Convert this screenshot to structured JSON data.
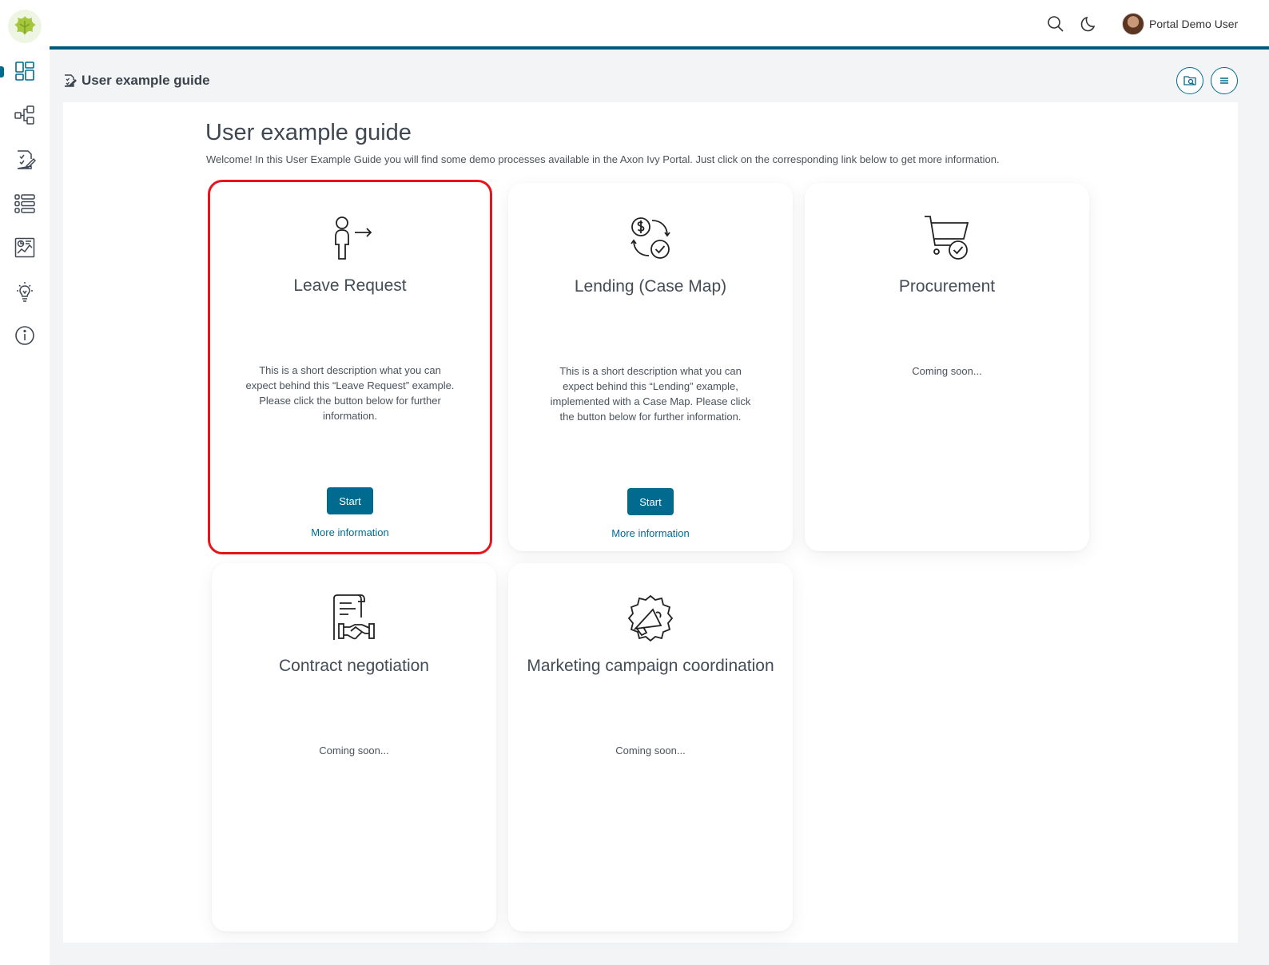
{
  "app": {
    "user_name": "Portal Demo User"
  },
  "sidebar": {
    "items": [
      {
        "icon": "dashboard-icon"
      },
      {
        "icon": "processes-icon"
      },
      {
        "icon": "tasks-icon"
      },
      {
        "icon": "cases-icon"
      },
      {
        "icon": "statistics-icon"
      },
      {
        "icon": "idea-icon"
      },
      {
        "icon": "info-icon"
      }
    ]
  },
  "page": {
    "header_title": "User example guide",
    "title": "User example guide",
    "intro": "Welcome! In this User Example Guide you will find some demo processes available in the Axon Ivy Portal. Just click on the corresponding link below to get more information."
  },
  "cards": [
    {
      "title": "Leave Request",
      "description": "This is a short description what you can expect behind this “Leave Request” example. Please click the button below for further information.",
      "start_label": "Start",
      "more_label": "More information",
      "icon": "person-leave-icon"
    },
    {
      "title": "Lending (Case Map)",
      "description": "This is a short description what you can expect behind this “Lending” example, implemented with a Case Map. Please click the button below for further information.",
      "start_label": "Start",
      "more_label": "More information",
      "icon": "money-exchange-icon"
    },
    {
      "title": "Procurement",
      "description": "Coming soon...",
      "icon": "cart-check-icon"
    },
    {
      "title": "Contract negotiation",
      "description": "Coming soon...",
      "icon": "contract-handshake-icon"
    },
    {
      "title": "Marketing campaign coordination",
      "description": "Coming soon...",
      "icon": "megaphone-icon"
    }
  ],
  "colors": {
    "accent": "#006b8f",
    "highlight": "#e8141c"
  }
}
